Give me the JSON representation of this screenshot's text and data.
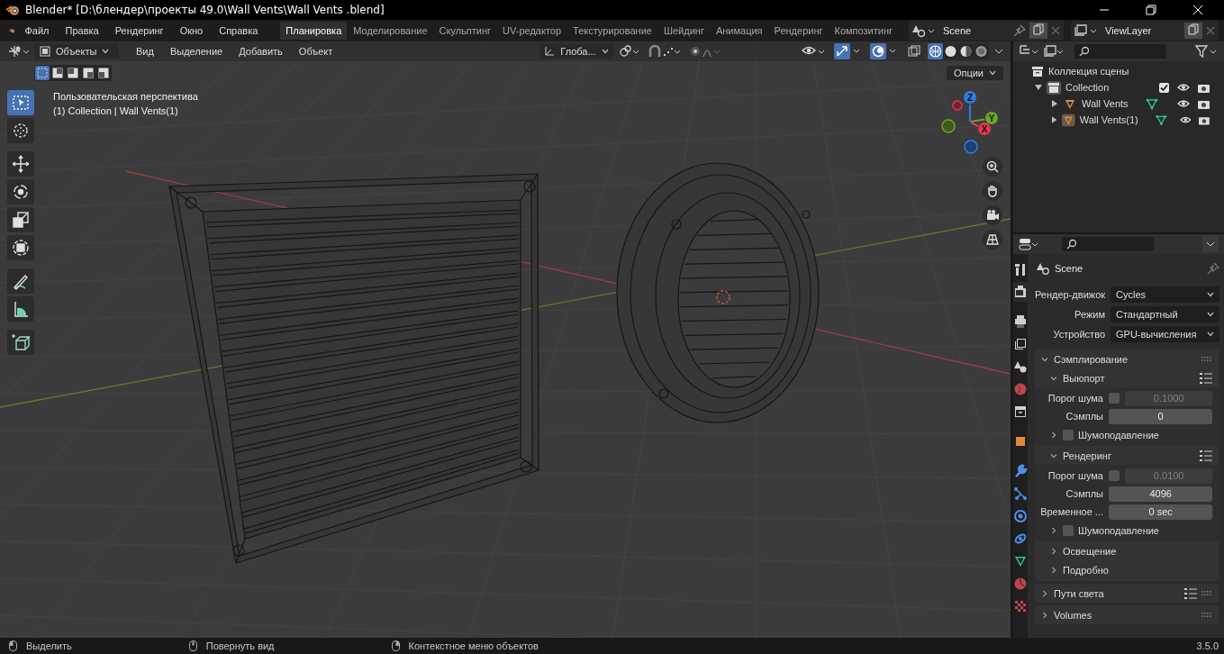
{
  "window": {
    "title": "Blender* [D:\\блендер\\проекты 49.0\\Wall Vents\\Wall Vents .blend]"
  },
  "menu": [
    "Файл",
    "Правка",
    "Рендеринг",
    "Окно",
    "Справка"
  ],
  "workspaces": [
    {
      "label": "Планировка",
      "selected": true
    },
    {
      "label": "Моделирование",
      "selected": false
    },
    {
      "label": "Скульптинг",
      "selected": false
    },
    {
      "label": "UV-редактор",
      "selected": false
    },
    {
      "label": "Текстурирование",
      "selected": false
    },
    {
      "label": "Шейдинг",
      "selected": false
    },
    {
      "label": "Анимация",
      "selected": false
    },
    {
      "label": "Рендеринг",
      "selected": false
    },
    {
      "label": "Композитинг",
      "selected": false
    }
  ],
  "scene": "Scene",
  "view_layer": "ViewLayer",
  "viewport": {
    "mode": "Объекты",
    "menus": [
      "Вид",
      "Выделение",
      "Добавить",
      "Объект"
    ],
    "orientation": "Глоба...",
    "options": "Опции",
    "view_name": "Пользовательская перспектива",
    "context": "(1) Collection | Wall Vents(1)",
    "select_modes": [
      {
        "selected": true
      },
      {
        "selected": false
      },
      {
        "selected": false
      },
      {
        "selected": false
      },
      {
        "selected": false
      }
    ],
    "shading": [
      {
        "kind": "wireframe",
        "selected": true
      },
      {
        "kind": "solid",
        "selected": false
      },
      {
        "kind": "material",
        "selected": false
      },
      {
        "kind": "rendered",
        "selected": false
      }
    ],
    "tools": [
      {
        "kind": "select",
        "selected": true
      },
      {
        "kind": "cursor",
        "selected": false
      },
      {
        "kind": "move",
        "selected": false
      },
      {
        "kind": "rotate",
        "selected": false
      },
      {
        "kind": "scale",
        "selected": false
      },
      {
        "kind": "transform",
        "selected": false
      },
      {
        "kind": "annotate",
        "selected": false
      },
      {
        "kind": "measure",
        "selected": false
      },
      {
        "kind": "add-cube",
        "selected": false
      }
    ],
    "axes": [
      "Z",
      "Y",
      "X"
    ]
  },
  "outliner": {
    "root": "Коллекция сцены",
    "tree": [
      {
        "name": "Collection",
        "expanded": true,
        "checked": true,
        "children": [
          {
            "name": "Wall Vents",
            "expanded": false,
            "selected": false
          },
          {
            "name": "Wall Vents(1)",
            "expanded": false,
            "selected": true
          }
        ]
      }
    ]
  },
  "properties": {
    "tabs": [
      {
        "kind": "tool",
        "selected": false
      },
      {
        "kind": "render",
        "selected": true
      },
      {
        "kind": "output",
        "selected": false
      },
      {
        "kind": "view-layer",
        "selected": false
      },
      {
        "kind": "scene",
        "selected": false
      },
      {
        "kind": "world",
        "selected": false
      },
      {
        "kind": "collection",
        "selected": false
      },
      {
        "kind": "object",
        "selected": false
      },
      {
        "kind": "modifier",
        "selected": false
      },
      {
        "kind": "particles",
        "selected": false
      },
      {
        "kind": "physics",
        "selected": false
      },
      {
        "kind": "constraints",
        "selected": false
      },
      {
        "kind": "data",
        "selected": false
      },
      {
        "kind": "material",
        "selected": false
      },
      {
        "kind": "texture",
        "selected": false
      }
    ],
    "context": "Scene",
    "fields": [
      {
        "label": "Рендер-движок",
        "value": "Cycles"
      },
      {
        "label": "Режим",
        "value": "Стандартный"
      },
      {
        "label": "Устройство",
        "value": "GPU-вычисления"
      }
    ],
    "panels": [
      {
        "kind": "panel",
        "title": "Сэмплирование",
        "expanded": true,
        "children": [
          {
            "kind": "panel",
            "title": "Выюпорт",
            "expanded": true,
            "presets": true,
            "children": [
              {
                "kind": "field",
                "label": "Порог шума",
                "checked": false,
                "value": "0.1000",
                "disabled": true
              },
              {
                "kind": "field",
                "label": "Сэмплы",
                "value": "0",
                "disabled": false
              },
              {
                "kind": "panel",
                "title": "Шумоподавление",
                "expanded": false,
                "checked": false
              }
            ]
          },
          {
            "kind": "panel",
            "title": "Рендеринг",
            "expanded": true,
            "presets": true,
            "children": [
              {
                "kind": "field",
                "label": "Порог шума",
                "checked": false,
                "value": "0.0100",
                "disabled": true
              },
              {
                "kind": "field",
                "label": "Сэмплы",
                "value": "4096",
                "disabled": false
              },
              {
                "kind": "field",
                "label": "Временное ...",
                "value": "0 sec",
                "disabled": false
              },
              {
                "kind": "panel",
                "title": "Шумоподавление",
                "expanded": false,
                "checked": false
              }
            ]
          },
          {
            "kind": "panel",
            "title": "Освещение",
            "expanded": false
          },
          {
            "kind": "panel",
            "title": "Подробно",
            "expanded": false
          }
        ]
      },
      {
        "kind": "panel",
        "title": "Пути света",
        "expanded": false,
        "presets": true
      },
      {
        "kind": "panel",
        "title": "Volumes",
        "expanded": false
      }
    ]
  },
  "status_bar": {
    "hints": [
      "Выделить",
      "Повернуть вид",
      "Контекстное меню объектов"
    ],
    "version": "3.5.0"
  }
}
